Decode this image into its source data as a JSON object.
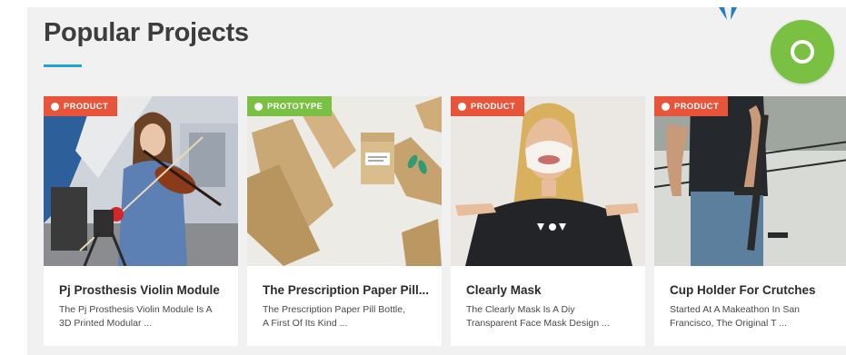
{
  "section": {
    "title": "Popular Projects",
    "underline_color": "#1fa4d6"
  },
  "fab": {
    "icon": "circle-ring-icon",
    "color": "#7ac143"
  },
  "cards": [
    {
      "badge": "PRODUCT",
      "badge_color": "#e8543a",
      "badge_icon": "dot-icon",
      "title": "Pj Prosthesis Violin Module",
      "desc_line1": "The Pj Prosthesis Violin Module Is A",
      "desc_line2": "3D Printed Modular ..."
    },
    {
      "badge": "PROTOTYPE",
      "badge_color": "#7ac143",
      "badge_icon": "dot-icon",
      "title": "The Prescription Paper Pill...",
      "desc_line1": "The Prescription Paper Pill Bottle,",
      "desc_line2": "A First Of Its Kind ..."
    },
    {
      "badge": "PRODUCT",
      "badge_color": "#e8543a",
      "badge_icon": "dot-icon",
      "title": "Clearly Mask",
      "desc_line1": "The Clearly Mask Is A Diy",
      "desc_line2": "Transparent Face Mask Design ..."
    },
    {
      "badge": "PRODUCT",
      "badge_color": "#e8543a",
      "badge_icon": "dot-icon",
      "title": "Cup Holder For Crutches",
      "desc_line1": "Started At A Makeathon In San",
      "desc_line2": "Francisco, The Original T ..."
    }
  ]
}
